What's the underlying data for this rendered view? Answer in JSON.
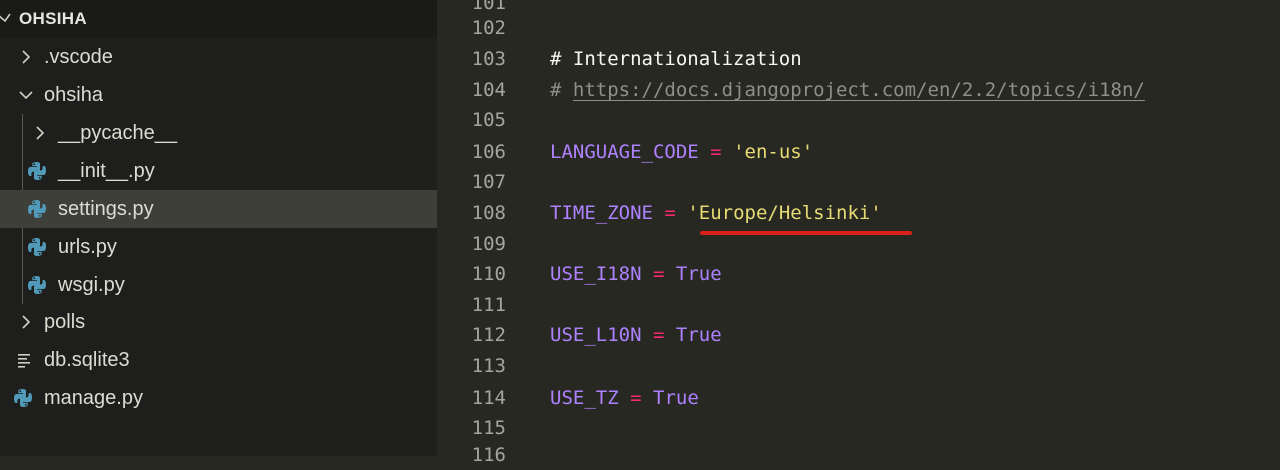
{
  "explorer": {
    "folder": "OHSIHA",
    "items": [
      {
        "label": ".vscode",
        "kind": "folder-collapsed"
      },
      {
        "label": "ohsiha",
        "kind": "folder-expanded"
      },
      {
        "label": "__pycache__",
        "kind": "folder-collapsed"
      },
      {
        "label": "__init__.py",
        "kind": "python"
      },
      {
        "label": "settings.py",
        "kind": "python",
        "selected": true
      },
      {
        "label": "urls.py",
        "kind": "python"
      },
      {
        "label": "wsgi.py",
        "kind": "python"
      },
      {
        "label": "polls",
        "kind": "folder-collapsed"
      },
      {
        "label": "db.sqlite3",
        "kind": "file"
      },
      {
        "label": "manage.py",
        "kind": "python"
      }
    ]
  },
  "editor": {
    "lines": [
      {
        "n": "101",
        "text": ""
      },
      {
        "n": "102",
        "text": ""
      },
      {
        "n": "103",
        "comment": "# Internationalization"
      },
      {
        "n": "104",
        "comment": "# ",
        "url": "https://docs.djangoproject.com/en/2.2/topics/i18n/"
      },
      {
        "n": "105",
        "text": ""
      },
      {
        "n": "106",
        "name": "LANGUAGE_CODE",
        "op": "=",
        "value": "'en-us'"
      },
      {
        "n": "107",
        "text": ""
      },
      {
        "n": "108",
        "name": "TIME_ZONE",
        "op": "=",
        "value": "'Europe/Helsinki'"
      },
      {
        "n": "109",
        "text": ""
      },
      {
        "n": "110",
        "name": "USE_I18N",
        "op": "=",
        "value": "True"
      },
      {
        "n": "111",
        "text": ""
      },
      {
        "n": "112",
        "name": "USE_L10N",
        "op": "=",
        "value": "True"
      },
      {
        "n": "113",
        "text": ""
      },
      {
        "n": "114",
        "name": "USE_TZ",
        "op": "=",
        "value": "True"
      },
      {
        "n": "115",
        "text": ""
      },
      {
        "n": "116",
        "text": ""
      }
    ]
  },
  "colors": {
    "sidebar_bg": "#1e1f1c",
    "editor_bg": "#272822",
    "selected_row": "#3e3f39",
    "python_icon": "#519aba",
    "comment": "#908f86",
    "constant": "#ae81ff",
    "operator": "#f92672",
    "string": "#e6db74",
    "annotation_underline": "#d9221a"
  }
}
